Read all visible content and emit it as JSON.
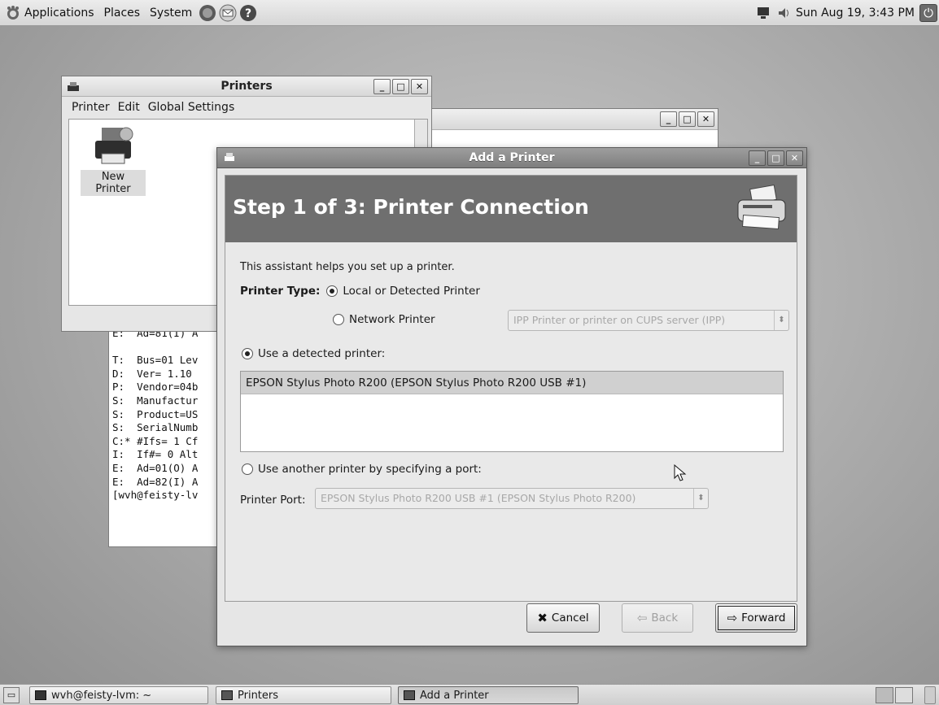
{
  "top_panel": {
    "menus": [
      "Applications",
      "Places",
      "System"
    ],
    "clock": "Sun Aug 19,  3:43 PM"
  },
  "terminal": {
    "title": "~",
    "lines": [
      "E:  Ad=81(I) A",
      "",
      "T:  Bus=01 Lev",
      "D:  Ver= 1.10",
      "P:  Vendor=04b",
      "S:  Manufactur",
      "S:  Product=US",
      "S:  SerialNumb",
      "C:* #Ifs= 1 Cf",
      "I:  If#= 0 Alt",
      "E:  Ad=01(O) A",
      "E:  Ad=82(I) A",
      "[wvh@feisty-lv"
    ]
  },
  "printers_window": {
    "title": "Printers",
    "menus": [
      "Printer",
      "Edit",
      "Global Settings"
    ],
    "new_printer_label": "New Printer"
  },
  "dialog": {
    "title": "Add a Printer",
    "step_title": "Step 1 of 3: Printer Connection",
    "intro": "This assistant helps you set up a printer.",
    "printer_type_label": "Printer Type:",
    "local_option": "Local or Detected Printer",
    "network_option": "Network Printer",
    "network_protocol": "IPP Printer or printer on CUPS server (IPP)",
    "use_detected": "Use a detected printer:",
    "detected_printers": [
      "EPSON Stylus Photo R200 (EPSON Stylus Photo R200 USB #1)"
    ],
    "use_another": "Use another printer by specifying a port:",
    "port_label": "Printer Port:",
    "port_value": "EPSON Stylus Photo R200 USB #1 (EPSON Stylus Photo R200)",
    "buttons": {
      "cancel": "Cancel",
      "back": "Back",
      "forward": "Forward"
    }
  },
  "taskbar": {
    "tasks": [
      "wvh@feisty-lvm: ~",
      "Printers",
      "Add a Printer"
    ]
  }
}
